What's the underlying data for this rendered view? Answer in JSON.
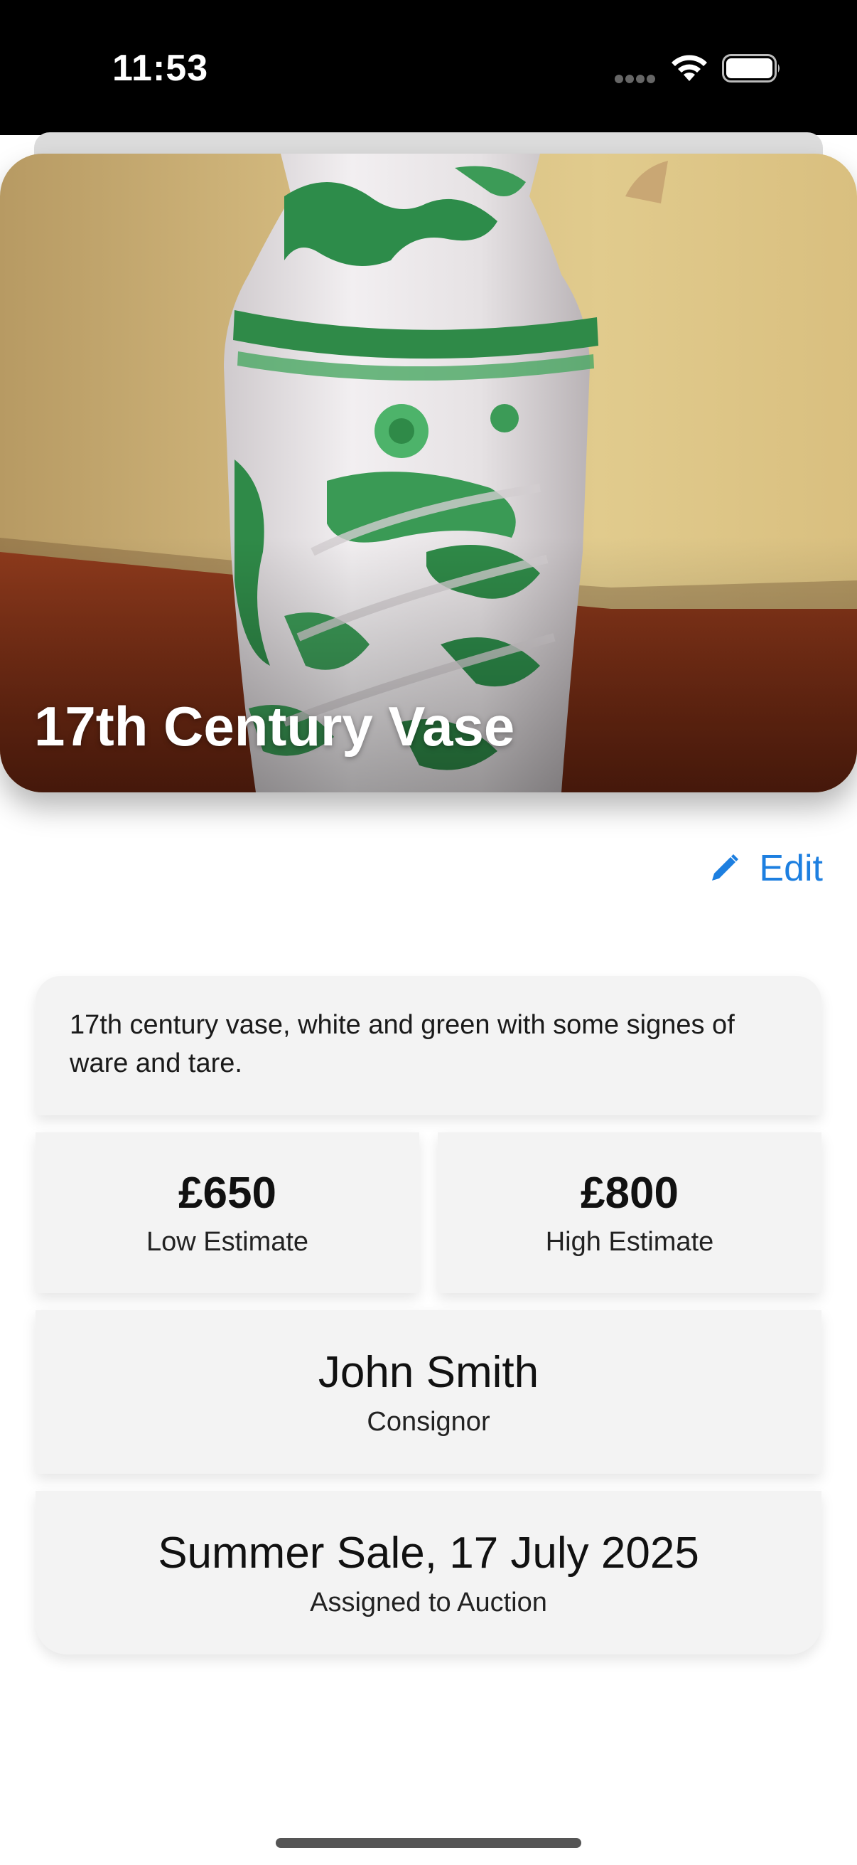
{
  "status_bar": {
    "time": "11:53"
  },
  "item": {
    "title": "17th Century Vase",
    "description": "17th century vase, white and green with some signes of ware and tare.",
    "photo_icon": "vase-photo"
  },
  "actions": {
    "edit_label": "Edit",
    "edit_icon": "pencil-icon",
    "accent_color": "#1d7fe0"
  },
  "estimates": {
    "low_value": "£650",
    "low_label": "Low Estimate",
    "high_value": "£800",
    "high_label": "High Estimate"
  },
  "consignor": {
    "name": "John Smith",
    "label": "Consignor"
  },
  "auction": {
    "name": "Summer Sale, 17 July 2025",
    "label": "Assigned to Auction"
  }
}
